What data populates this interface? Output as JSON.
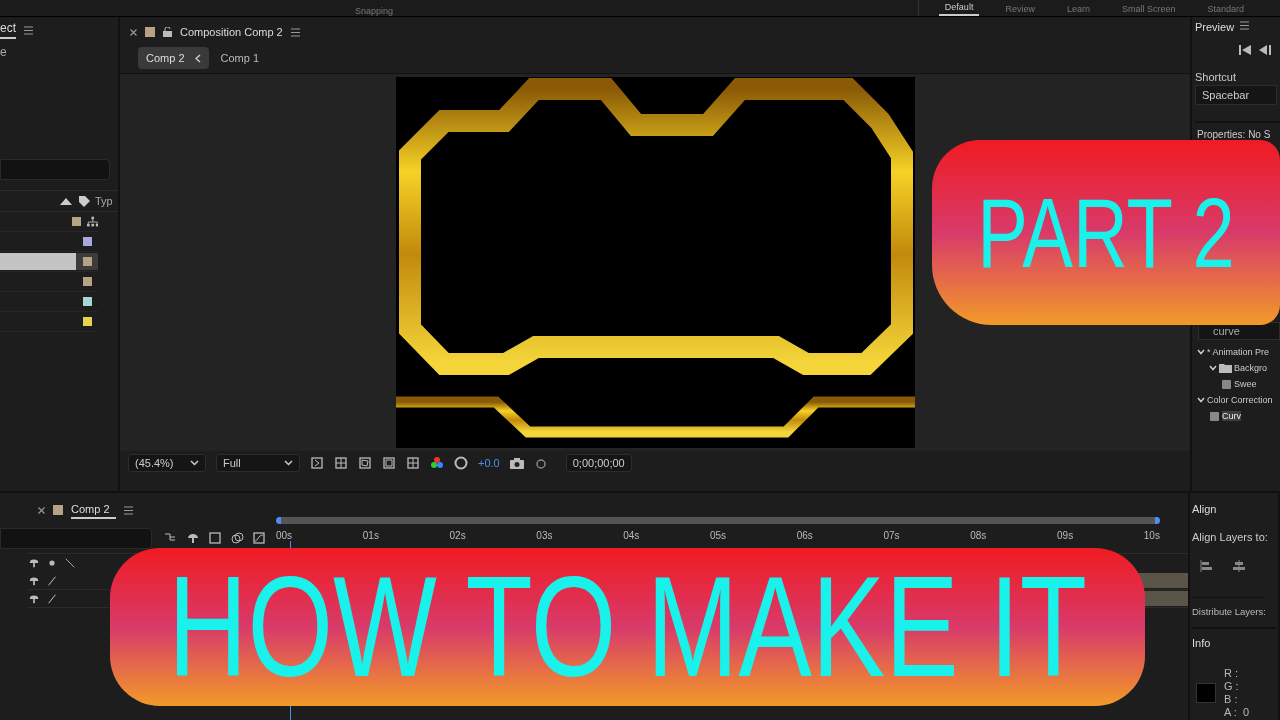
{
  "workspace_bar": {
    "snapping": "Snapping",
    "tabs": [
      {
        "label": "Default",
        "selected": true
      },
      {
        "label": "Review",
        "selected": false
      },
      {
        "label": "Learn",
        "selected": false
      },
      {
        "label": "Small Screen",
        "selected": false
      },
      {
        "label": "Standard",
        "selected": false
      }
    ]
  },
  "project_panel": {
    "tab": "ect",
    "subtitle": "e",
    "type_column": "Typ",
    "items": [
      {
        "color": "#b5a383",
        "selected": false
      },
      {
        "color": "#a9a8dd",
        "selected": false
      },
      {
        "color": "#b5a383",
        "selected": true
      },
      {
        "color": "#b5a383",
        "selected": false
      },
      {
        "color": "#a6d6d4",
        "selected": false
      },
      {
        "color": "#e6d44c",
        "selected": false
      }
    ]
  },
  "composition_panel": {
    "tab": "Composition Comp 2",
    "breadcrumbs": [
      {
        "label": "Comp 2",
        "selected": true
      },
      {
        "label": "Comp 1",
        "selected": false
      }
    ],
    "toolbar": {
      "zoom": "(45.4%)",
      "resolution": "Full",
      "exposure": "+0.0",
      "timecode": "0;00;00;00"
    }
  },
  "preview_panel": {
    "title": "Preview",
    "shortcut_label": "Shortcut",
    "shortcut": "Spacebar"
  },
  "properties_panel": {
    "title": "Properties: No S"
  },
  "effects_panel": {
    "search": "curve",
    "tree": [
      {
        "label": "* Animation Pre",
        "expanded": true,
        "selected": false,
        "children": [
          {
            "label": "Backgro",
            "expanded": true,
            "selected": false,
            "children": [
              {
                "label": "Swee",
                "selected": false
              }
            ]
          }
        ]
      },
      {
        "label": "Color Correction",
        "expanded": true,
        "selected": false,
        "children": [
          {
            "label": "Curv",
            "selected": true
          }
        ]
      }
    ]
  },
  "align_panel": {
    "title": "Align",
    "align_label": "Align Layers to:",
    "distribute_label": "Distribute Layers:"
  },
  "info_panel": {
    "title": "Info",
    "channels": [
      "R :",
      "G :",
      "B :",
      "A :  0"
    ]
  },
  "timeline": {
    "tab": "Comp 2",
    "ruler": [
      "00s",
      "01s",
      "02s",
      "03s",
      "04s",
      "05s",
      "06s",
      "07s",
      "08s",
      "09s",
      "10s"
    ]
  },
  "overlays": {
    "part_title": "PART 2",
    "headline": "HOW TO MAKE IT"
  }
}
